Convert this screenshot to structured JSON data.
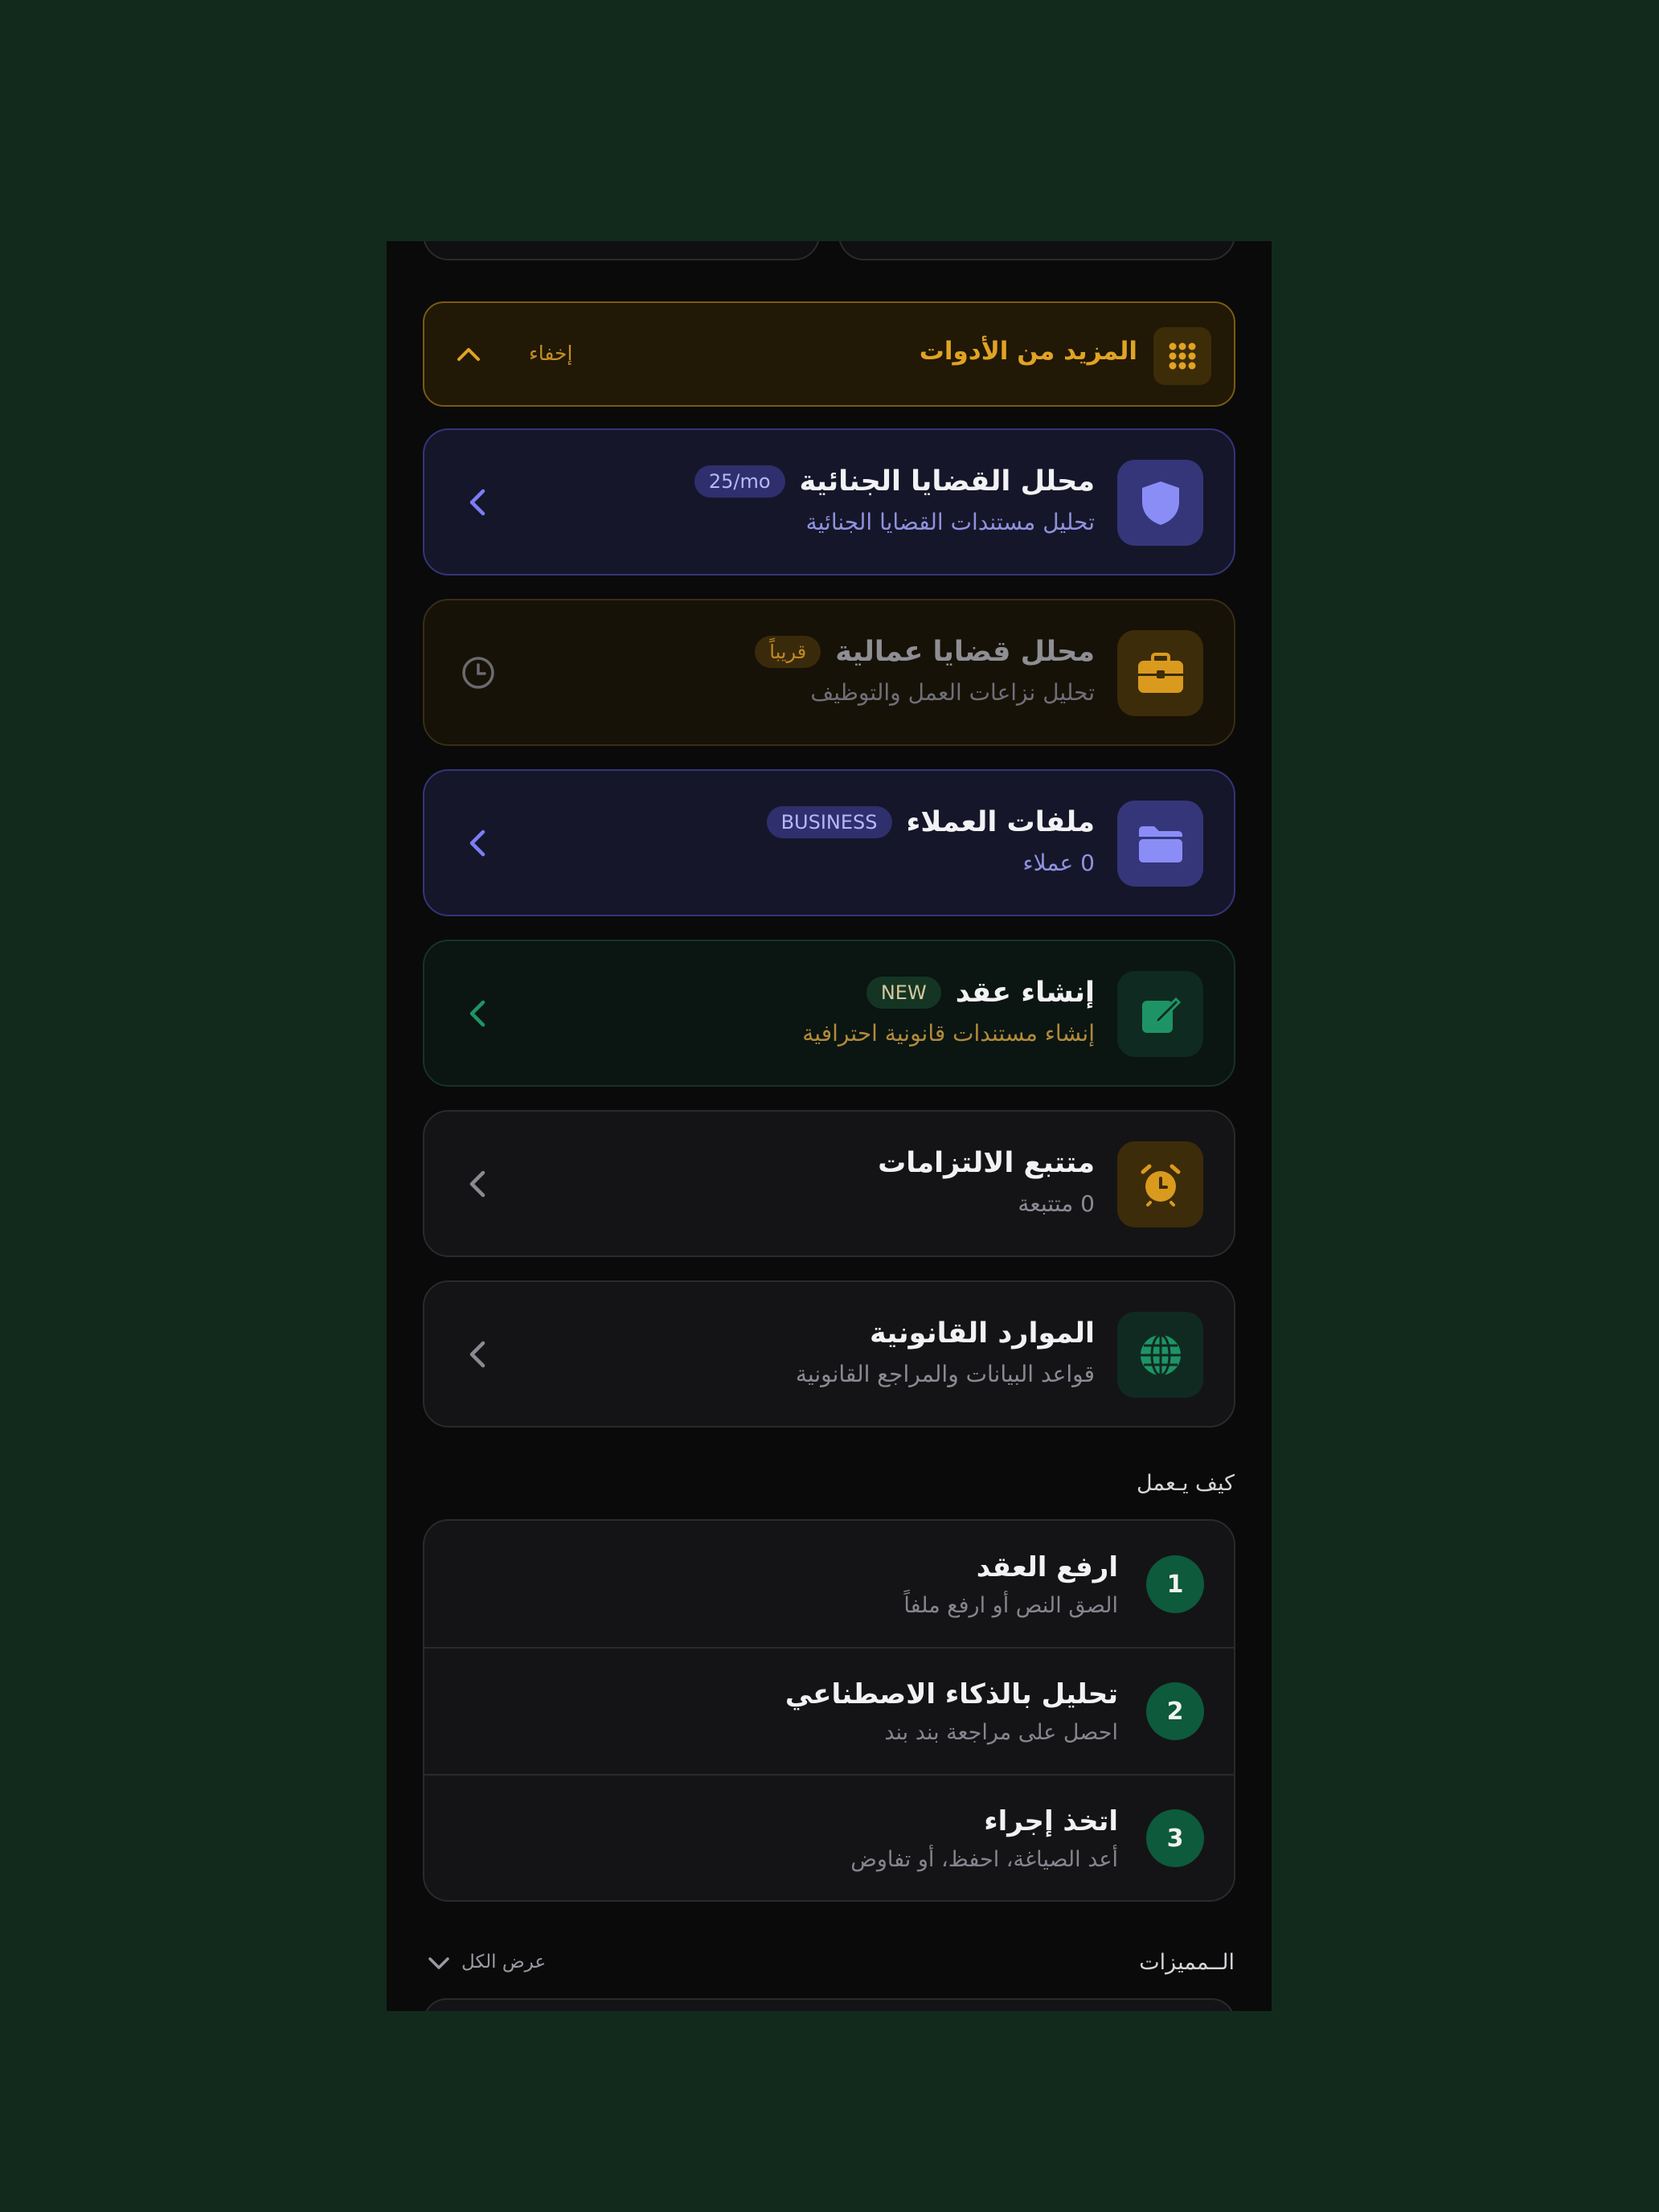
{
  "top_stubs": {
    "left_text": "",
    "right_text": ""
  },
  "more_tools": {
    "title": "المزيد من الأدوات",
    "hide_label": "إخفاء",
    "icon": "grid-dots-icon"
  },
  "tools": [
    {
      "id": "criminal",
      "title": "محلل القضايا الجنائية",
      "subtitle": "تحليل مستندات القضايا الجنائية",
      "badge": "25/mo",
      "icon": "shield-icon",
      "action": "chevron-left-icon",
      "accent": "#7b7ef5"
    },
    {
      "id": "labor",
      "title": "محلل قضايا عمالية",
      "subtitle": "تحليل نزاعات العمل والتوظيف",
      "badge": "قريباً",
      "icon": "briefcase-icon",
      "action": "clock-icon",
      "accent": "#d99a1e"
    },
    {
      "id": "clients",
      "title": "ملفات العملاء",
      "subtitle": "0 عملاء",
      "badge": "BUSINESS",
      "icon": "folder-icon",
      "action": "chevron-left-icon",
      "accent": "#7b7ef5"
    },
    {
      "id": "contract",
      "title": "إنشاء عقد",
      "subtitle": "إنشاء مستندات قانونية احترافية",
      "badge": "NEW",
      "icon": "edit-icon",
      "action": "chevron-left-icon",
      "accent": "#1e9466"
    },
    {
      "id": "obligations",
      "title": "متتبع الالتزامات",
      "subtitle": "0 متتبعة",
      "badge": "",
      "icon": "alarm-clock-icon",
      "action": "chevron-left-icon",
      "accent": "#d99a1e"
    },
    {
      "id": "resources",
      "title": "الموارد القانونية",
      "subtitle": "قواعد البيانات والمراجع القانونية",
      "badge": "",
      "icon": "globe-icon",
      "action": "chevron-left-icon",
      "accent": "#1e9466"
    }
  ],
  "how_it_works": {
    "title": "كيف يـعمل",
    "steps": [
      {
        "num": "1",
        "title": "ارفع العقد",
        "subtitle": "الصق النص أو ارفع ملفاً"
      },
      {
        "num": "2",
        "title": "تحليل بالذكاء الاصطناعي",
        "subtitle": "احصل على مراجعة بند بند"
      },
      {
        "num": "3",
        "title": "اتخذ إجراء",
        "subtitle": "أعد الصياغة، احفظ، أو تفاوض"
      }
    ]
  },
  "features": {
    "title": "الــمميزات",
    "view_all": "عرض الكل"
  }
}
